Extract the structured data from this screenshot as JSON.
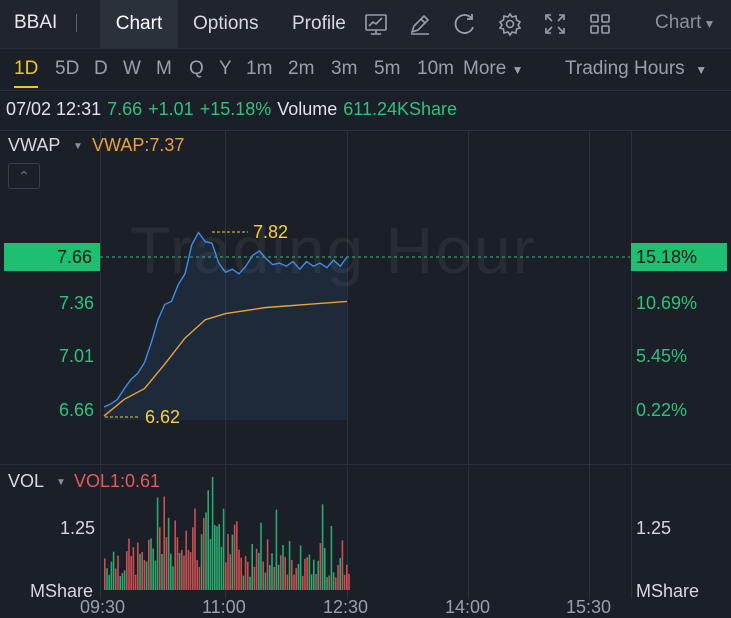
{
  "header": {
    "ticker": "BBAI",
    "tabs": [
      {
        "label": "Chart",
        "active": true
      },
      {
        "label": "Options",
        "active": false
      },
      {
        "label": "Profile",
        "active": false
      }
    ],
    "tools": [
      "indicator-icon",
      "draw-icon",
      "refresh-icon",
      "settings-icon",
      "fullscreen-icon",
      "layout-grid-icon"
    ],
    "chart_type_label": "Chart"
  },
  "periods": {
    "items": [
      "1D",
      "5D",
      "D",
      "W",
      "M",
      "Q",
      "Y",
      "1m",
      "2m",
      "3m",
      "5m",
      "10m"
    ],
    "active": "1D",
    "more_label": "More",
    "session_label": "Trading Hours"
  },
  "quote": {
    "datetime": "07/02 12:31",
    "price": "7.66",
    "change": "+1.01",
    "change_pct": "+15.18%",
    "volume_label": "Volume",
    "volume_value": "611.24KShare"
  },
  "indicators": {
    "main_label": "VWAP",
    "main_value": "VWAP:7.37",
    "vol_label": "VOL",
    "vol_value": "VOL1:0.61",
    "watermark": "Trading Hour"
  },
  "axes": {
    "price_ticks": [
      "7.36",
      "7.01",
      "6.66"
    ],
    "pct_ticks": [
      "10.69%",
      "5.45%",
      "0.22%"
    ],
    "current_price": "7.66",
    "current_pct": "15.18%",
    "high_label": "7.82",
    "low_label": "6.62",
    "vol_tick": "1.25",
    "vol_unit": "MShare",
    "time_ticks": [
      "09:30",
      "11:00",
      "12:30",
      "14:00",
      "15:30"
    ]
  },
  "colors": {
    "price_line": "#3d8ee6",
    "vwap_line": "#e8a33a",
    "up": "#2ec27e",
    "down": "#e55b5b",
    "accent": "#f5c518"
  },
  "chart_data": {
    "type": "line",
    "series": [
      {
        "name": "Price",
        "x_minutes_from_open": [
          0,
          5,
          10,
          15,
          20,
          25,
          30,
          35,
          40,
          45,
          50,
          55,
          60,
          65,
          70,
          75,
          80,
          85,
          90,
          95,
          100,
          105,
          110,
          115,
          120,
          125,
          130,
          135,
          140,
          145,
          150,
          155,
          160,
          165,
          170,
          175,
          180
        ],
        "values": [
          6.68,
          6.7,
          6.73,
          6.8,
          6.86,
          6.9,
          6.97,
          7.1,
          7.25,
          7.35,
          7.37,
          7.48,
          7.55,
          7.74,
          7.82,
          7.76,
          7.75,
          7.62,
          7.56,
          7.58,
          7.55,
          7.6,
          7.67,
          7.7,
          7.65,
          7.61,
          7.62,
          7.6,
          7.63,
          7.58,
          7.63,
          7.6,
          7.62,
          7.59,
          7.64,
          7.6,
          7.66
        ]
      },
      {
        "name": "VWAP",
        "x_minutes_from_open": [
          0,
          15,
          30,
          45,
          60,
          75,
          90,
          105,
          120,
          135,
          150,
          165,
          180
        ],
        "values": [
          6.62,
          6.73,
          6.8,
          6.96,
          7.13,
          7.25,
          7.29,
          7.31,
          7.33,
          7.34,
          7.35,
          7.36,
          7.37
        ]
      }
    ],
    "ylim": [
      6.6,
      7.85
    ],
    "x_ticks": [
      "09:30",
      "11:00",
      "12:30",
      "14:00",
      "15:30"
    ]
  }
}
